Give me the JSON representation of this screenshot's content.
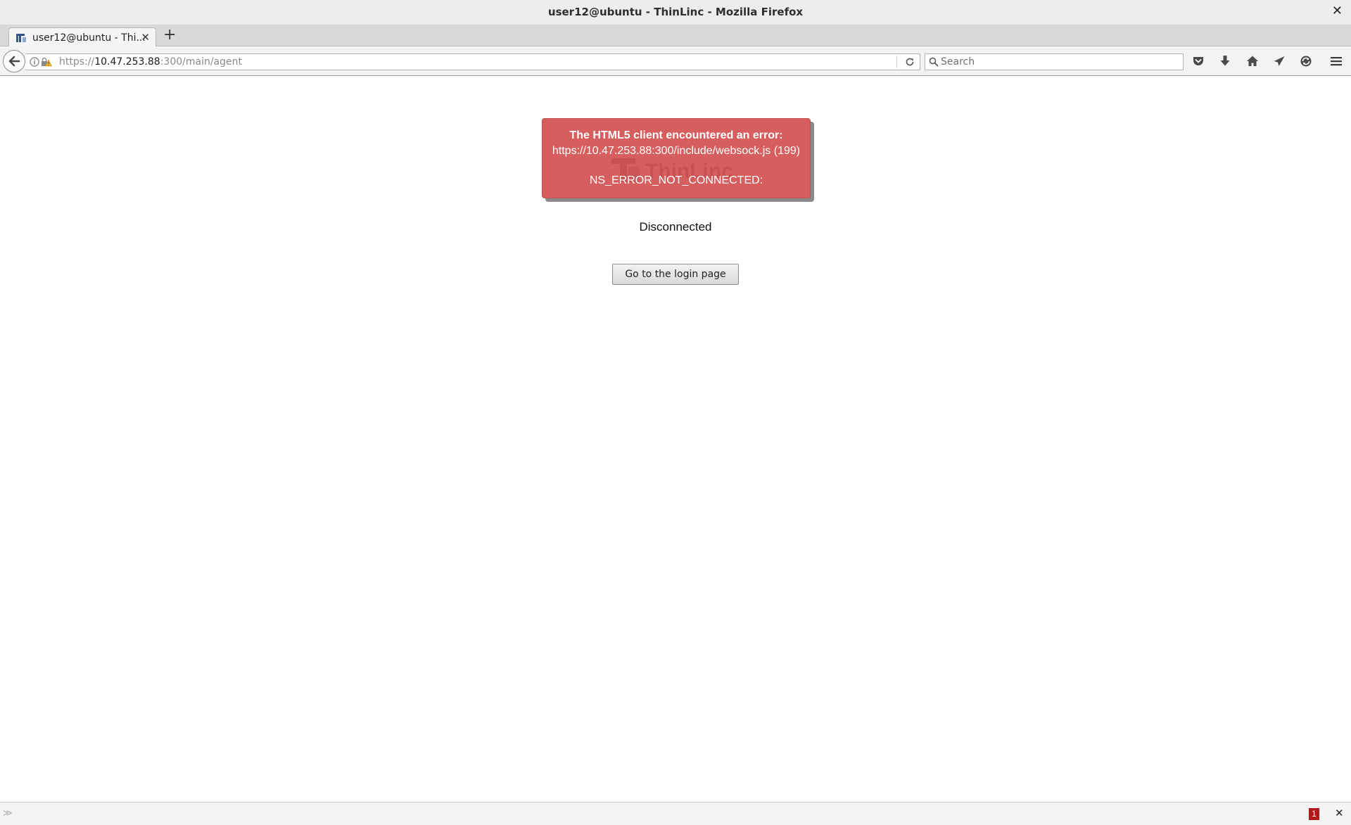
{
  "window": {
    "title": "user12@ubuntu - ThinLinc - Mozilla Firefox",
    "close_glyph": "✕"
  },
  "tabs": [
    {
      "label": "user12@ubuntu - Thi...",
      "icon": "thinlinc-favicon-icon",
      "close_glyph": "✕"
    }
  ],
  "new_tab_glyph": "+",
  "navbar": {
    "url_scheme": "https://",
    "url_host": "10.47.253.88",
    "url_rest": ":300/main/agent",
    "search_placeholder": "Search",
    "icons": [
      "back-arrow-icon",
      "info-icon",
      "insecure-lock-icon",
      "reload-icon",
      "search-icon",
      "pocket-icon",
      "download-icon",
      "home-icon",
      "send-icon",
      "sync-icon",
      "hamburger-menu-icon"
    ]
  },
  "error_box": {
    "title": "The HTML5 client encountered an error:",
    "url": "https://10.47.253.88:300/include/websock.js (199)",
    "code": "NS_ERROR_NOT_CONNECTED:",
    "background_color": "#d75e5e",
    "watermark_text": "ThinLinc"
  },
  "status": {
    "text": "Disconnected"
  },
  "login_button": {
    "label": "Go to the login page"
  },
  "bottom_bar": {
    "arrows_glyph": "≫",
    "badge_count": "1",
    "badge_color": "#b01a1a",
    "close_glyph": "✕"
  }
}
